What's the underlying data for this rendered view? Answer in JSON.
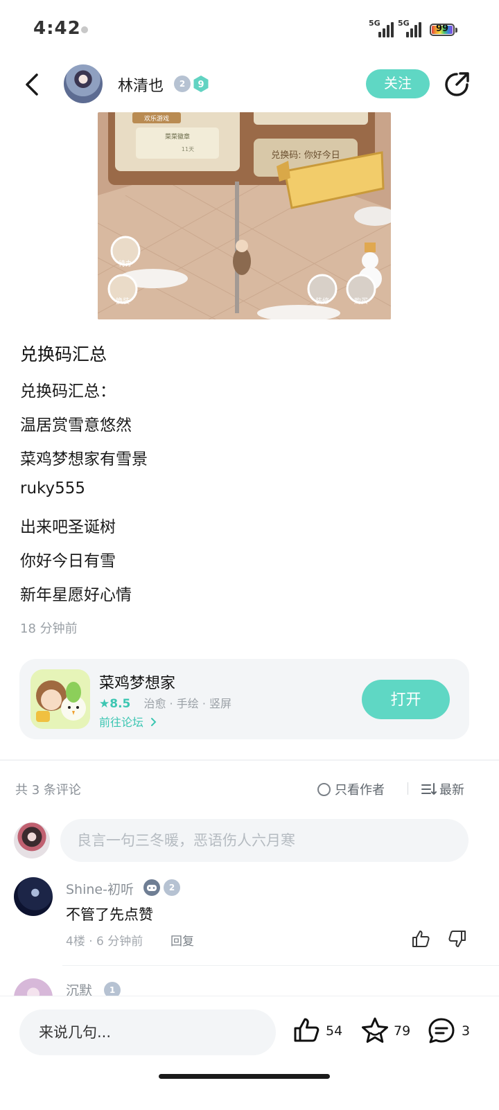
{
  "status_bar": {
    "time": "4:42",
    "network_1": "5G",
    "network_2": "5G",
    "battery": "99"
  },
  "header": {
    "author_name": "林清也",
    "badge_level": "2",
    "badge_hex": "9",
    "follow_label": "关注",
    "accent_color": "#5fd7c4"
  },
  "post": {
    "title": "兑换码汇总",
    "lines": [
      "兑换码汇总：",
      "温居赏雪意悠然",
      "菜鸡梦想家有雪景",
      "ruky555",
      "出来吧圣诞树",
      "你好今日有雪",
      "新年星愿好心情"
    ],
    "time": "18 分钟前",
    "image": {
      "tag_1": "欢乐游戏",
      "tag_2": "菜菜徽章",
      "tag_3": "11天",
      "sign": "兑换码: 你好今日",
      "btn_todo": "待办",
      "btn_dress": "换装",
      "btn_decor": "装修",
      "btn_buy": "购买"
    }
  },
  "game_card": {
    "name": "菜鸡梦想家",
    "score": "8.5",
    "tags": "治愈 · 手绘 · 竖屏",
    "forum_link": "前往论坛",
    "open_label": "打开"
  },
  "comments_header": {
    "count_text": "共 3 条评论",
    "only_author": "只看作者",
    "sort": "最新"
  },
  "comment_input": {
    "placeholder": "良言一句三冬暖，恶语伤人六月寒"
  },
  "comments": [
    {
      "user": "Shine-初听",
      "badge": "2",
      "text": "不管了先点赞",
      "meta": "4楼 · 6 分钟前",
      "reply": "回复"
    },
    {
      "user": "沉默",
      "badge": "1"
    }
  ],
  "bottom_bar": {
    "say_placeholder": "来说几句...",
    "likes": "54",
    "stars": "79",
    "comments": "3"
  }
}
